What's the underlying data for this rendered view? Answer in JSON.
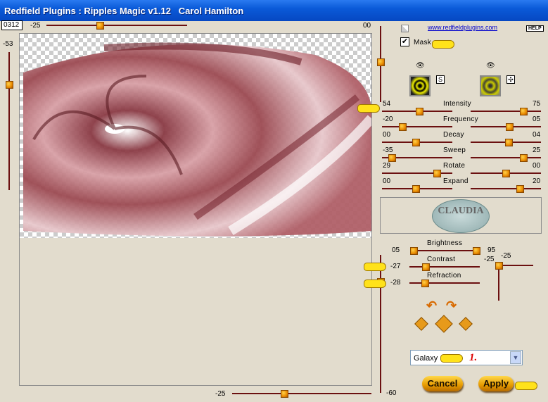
{
  "window": {
    "title": "Redfield Plugins : Ripples Magic v1.12   Carol Hamilton"
  },
  "seed": "0312",
  "preview_sliders": {
    "top_left": "-25",
    "top_right": "00",
    "left": "-53",
    "bottom": "-25",
    "right_bottom": "-60"
  },
  "link": "www.redfieldplugins.com",
  "help": "HELP",
  "mask": {
    "label": "Mask",
    "checked": true
  },
  "sliders": [
    {
      "label": "Intensity",
      "left": "54",
      "right": "75"
    },
    {
      "label": "Frequency",
      "left": "-20",
      "right": "05"
    },
    {
      "label": "Decay",
      "left": "00",
      "right": "04"
    },
    {
      "label": "Sweep",
      "left": "-35",
      "right": "25"
    },
    {
      "label": "Rotate",
      "left": "29",
      "right": "00"
    },
    {
      "label": "Expand",
      "left": "00",
      "right": "20"
    }
  ],
  "brightness": {
    "label": "Brightness",
    "low": "05",
    "high": "95"
  },
  "contrast": {
    "label": "Contrast",
    "value": "-27"
  },
  "refraction": {
    "label": "Refraction",
    "value": "-28"
  },
  "xy_pad": {
    "x": "-25",
    "y": "-25"
  },
  "logo_text": "CLAUDIA",
  "preset": {
    "selected": "Galaxy",
    "annotation": "1."
  },
  "buttons": {
    "cancel": "Cancel",
    "apply": "Apply"
  },
  "colors": {
    "title_bar": "#0a5ad8",
    "track": "#6b1010",
    "thumb": "#e98a00",
    "panel": "#e2dccd"
  }
}
